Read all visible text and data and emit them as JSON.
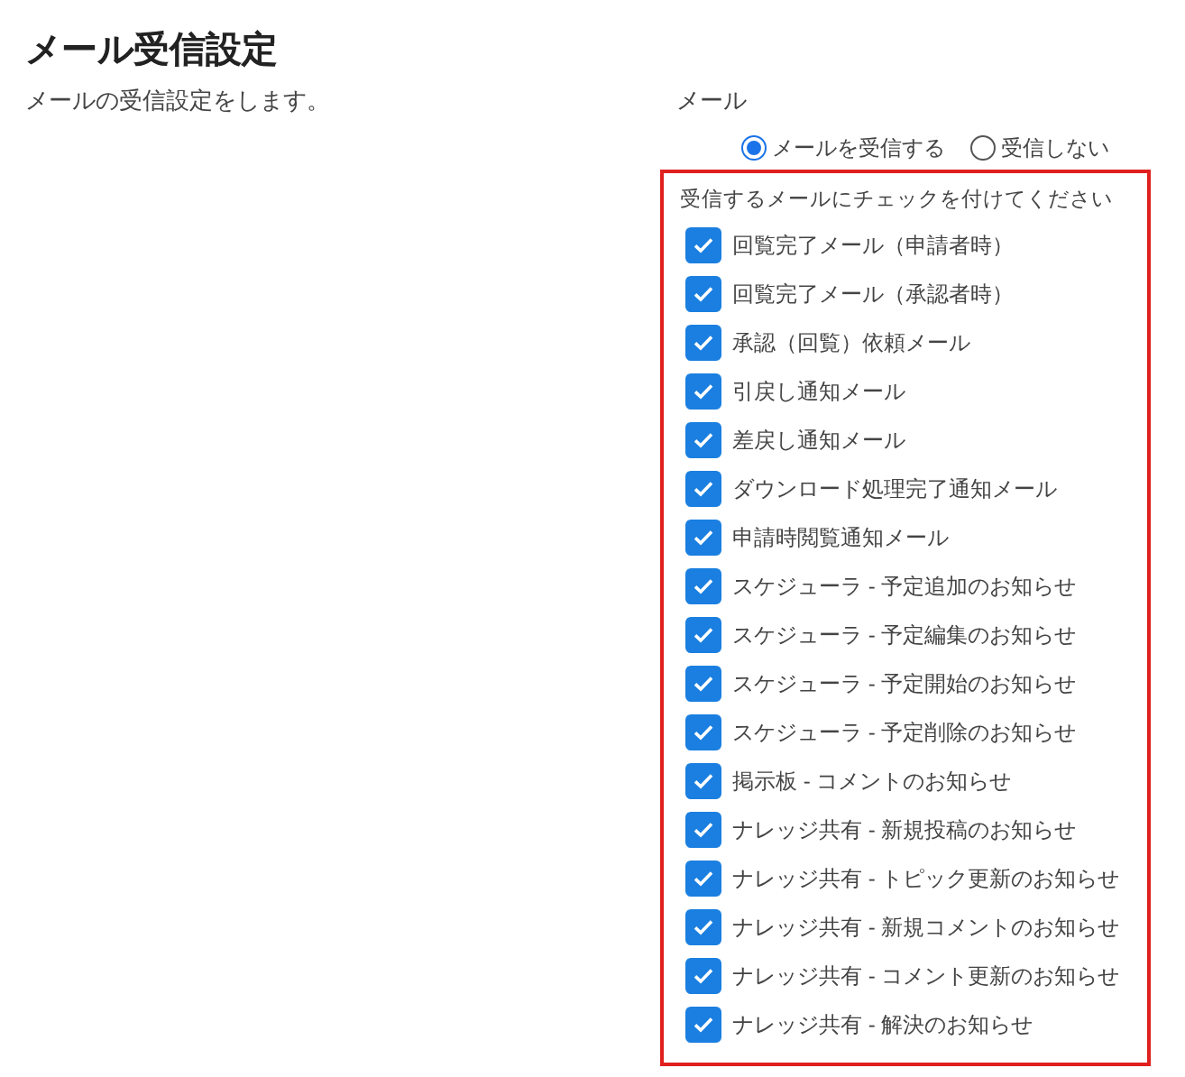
{
  "title": "メール受信設定",
  "description": "メールの受信設定をします。",
  "mail_setting": {
    "label": "メール",
    "options": [
      {
        "label": "メールを受信する",
        "selected": true
      },
      {
        "label": "受信しない",
        "selected": false
      }
    ],
    "instruction": "受信するメールにチェックを付けてください",
    "items": [
      {
        "label": "回覧完了メール（申請者時）",
        "checked": true
      },
      {
        "label": "回覧完了メール（承認者時）",
        "checked": true
      },
      {
        "label": "承認（回覧）依頼メール",
        "checked": true
      },
      {
        "label": "引戻し通知メール",
        "checked": true
      },
      {
        "label": "差戻し通知メール",
        "checked": true
      },
      {
        "label": "ダウンロード処理完了通知メール",
        "checked": true
      },
      {
        "label": "申請時閲覧通知メール",
        "checked": true
      },
      {
        "label": "スケジューラ - 予定追加のお知らせ",
        "checked": true
      },
      {
        "label": "スケジューラ - 予定編集のお知らせ",
        "checked": true
      },
      {
        "label": "スケジューラ - 予定開始のお知らせ",
        "checked": true
      },
      {
        "label": "スケジューラ - 予定削除のお知らせ",
        "checked": true
      },
      {
        "label": "掲示板 - コメントのお知らせ",
        "checked": true
      },
      {
        "label": "ナレッジ共有 - 新規投稿のお知らせ",
        "checked": true
      },
      {
        "label": "ナレッジ共有 - トピック更新のお知らせ",
        "checked": true
      },
      {
        "label": "ナレッジ共有 - 新規コメントのお知らせ",
        "checked": true
      },
      {
        "label": "ナレッジ共有 - コメント更新のお知らせ",
        "checked": true
      },
      {
        "label": "ナレッジ共有 - 解決のお知らせ",
        "checked": true
      }
    ]
  }
}
